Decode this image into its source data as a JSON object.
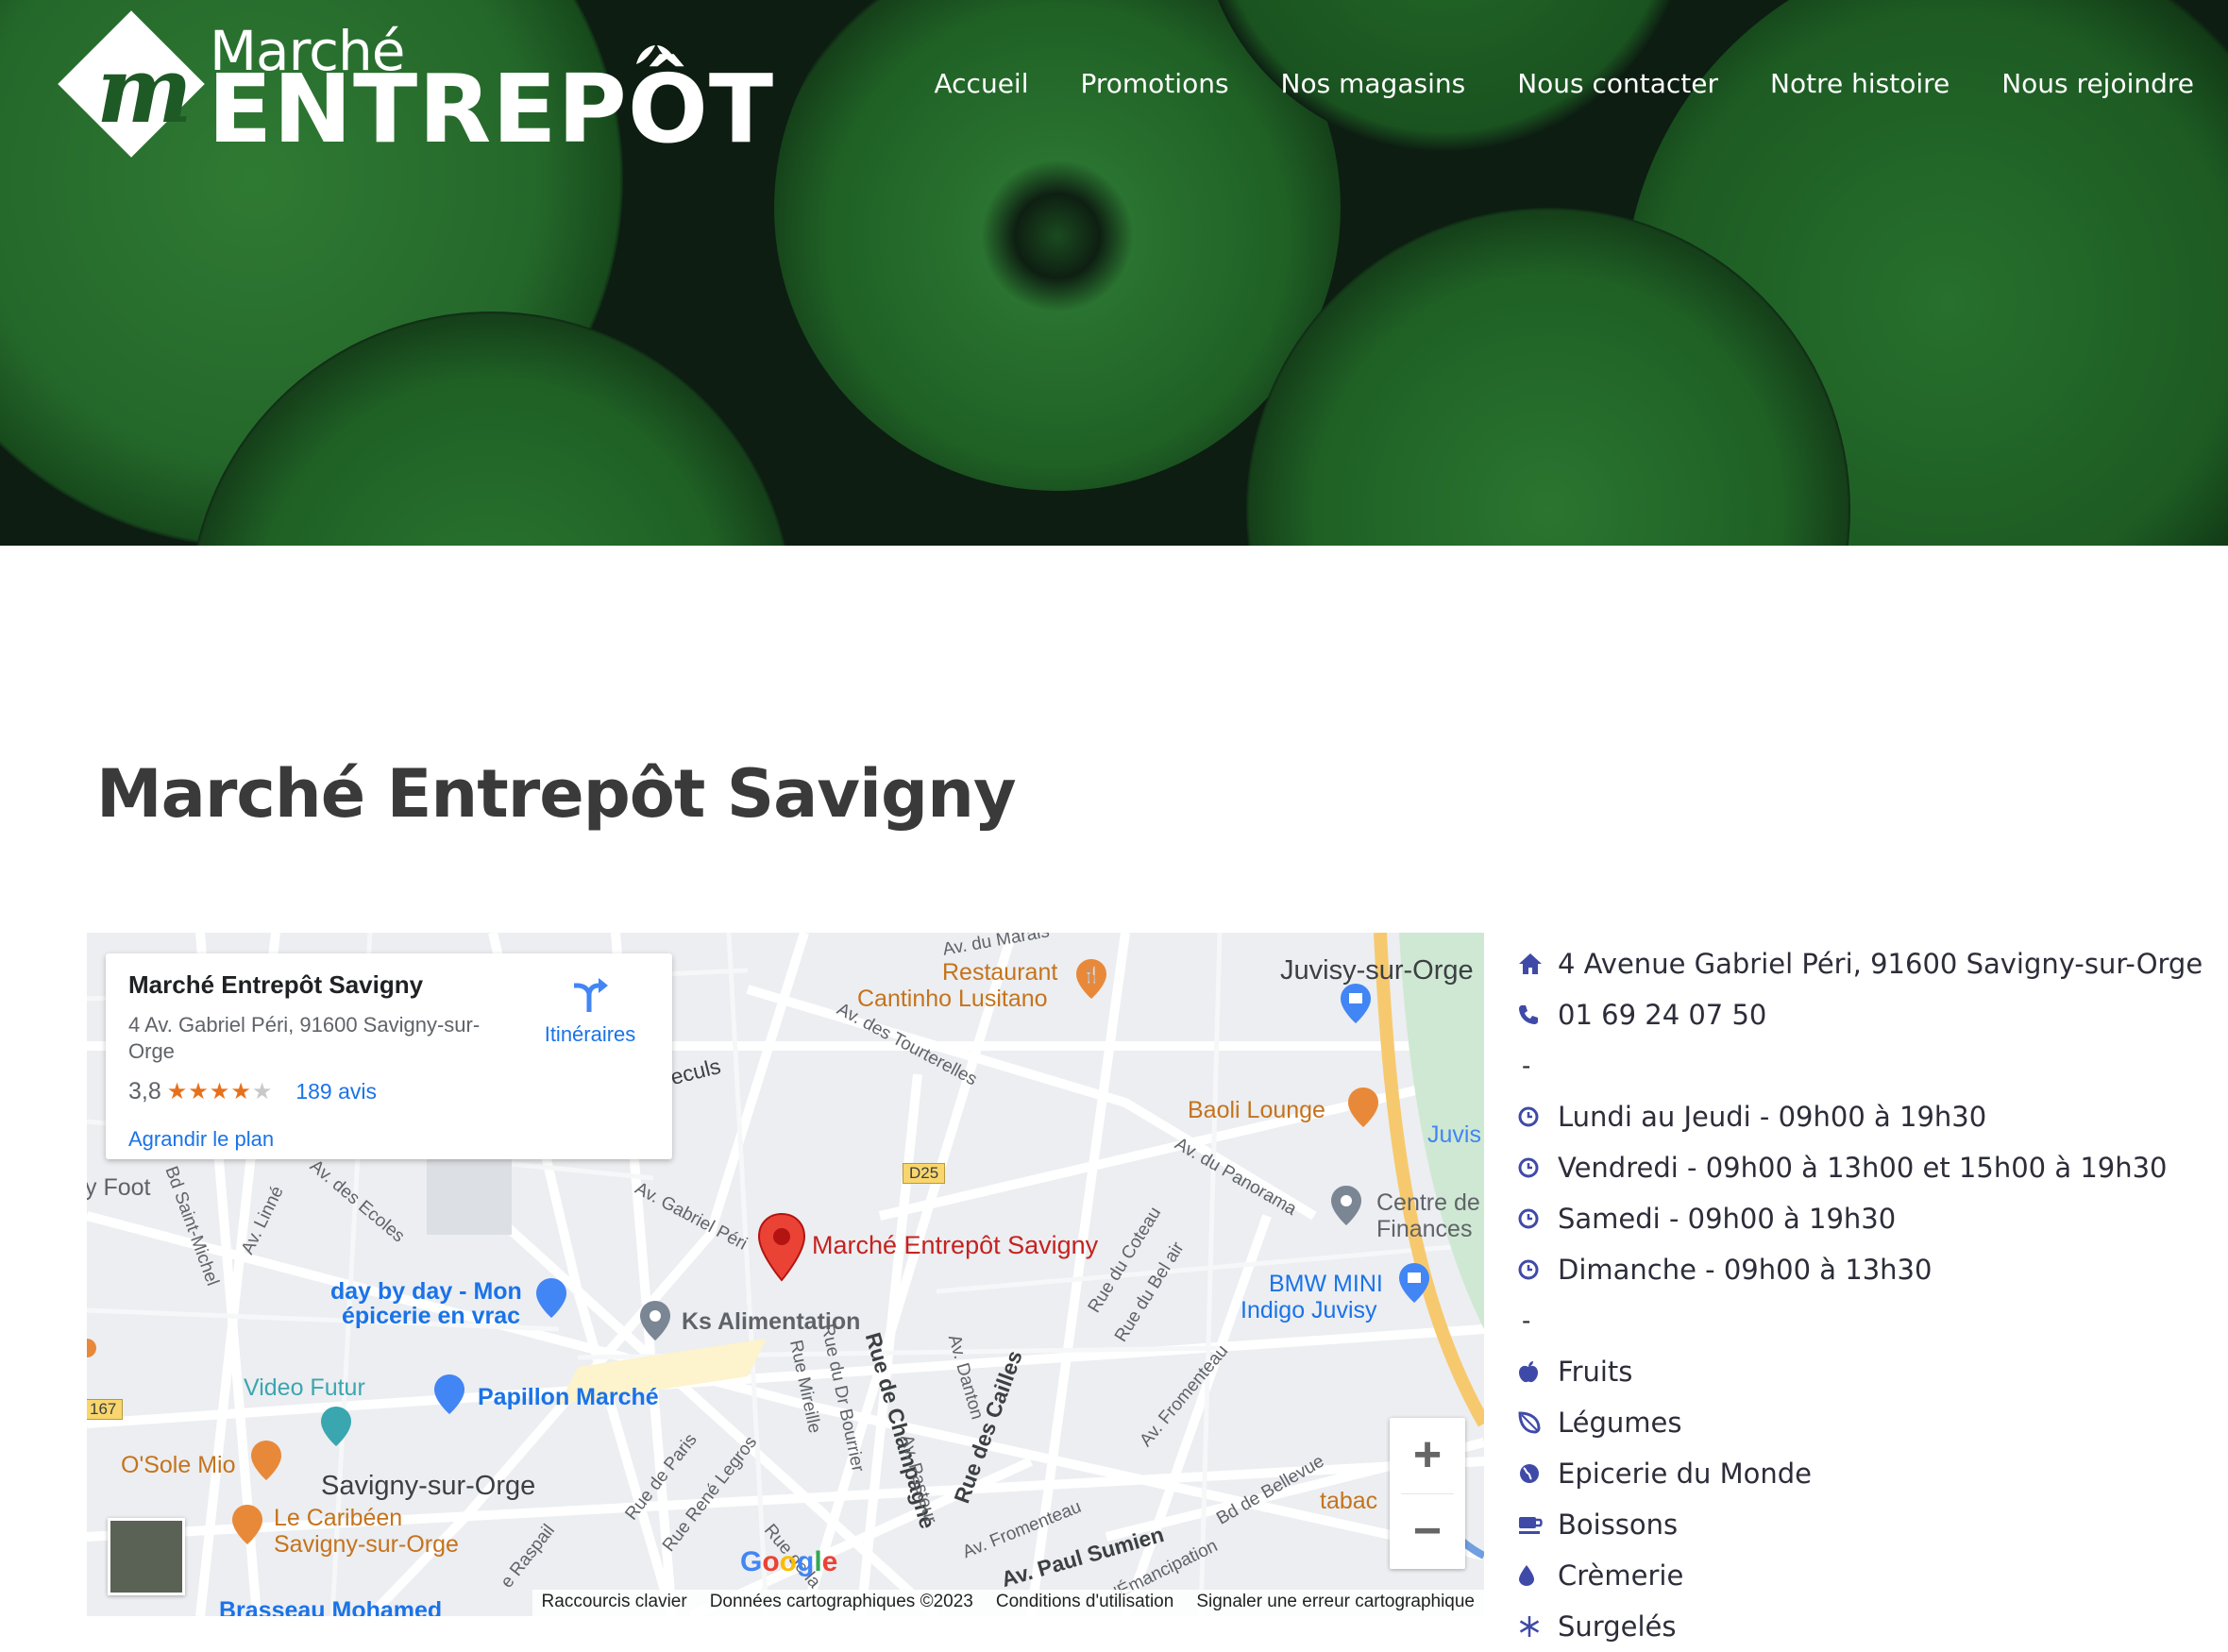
{
  "header": {
    "logo": {
      "top": "Marché",
      "bottom": "ENTREPÔT",
      "monogram": "m"
    },
    "nav": [
      {
        "label": "Accueil"
      },
      {
        "label": "Promotions"
      },
      {
        "label": "Nos magasins"
      },
      {
        "label": "Nous contacter"
      },
      {
        "label": "Notre histoire"
      },
      {
        "label": "Nous rejoindre"
      }
    ],
    "hero_tint": "#1e5a25"
  },
  "page_title": "Marché Entrepôt Savigny",
  "map": {
    "card": {
      "name": "Marché Entrepôt Savigny",
      "address": "4 Av. Gabriel Péri, 91600 Savigny-sur-Orge",
      "rating": "3,8",
      "rating_value": 3.8,
      "reviews": "189 avis",
      "directions": "Itinéraires",
      "enlarge": "Agrandir le plan"
    },
    "labels": {
      "pin": "Marché Entrepôt Savigny",
      "restaurant_1": "Restaurant",
      "restaurant_2": "Cantinho Lusitano",
      "juvisy": "Juvisy-sur-Orge",
      "juvis": "Juvis",
      "baoli": "Baoli Lounge",
      "centre_1": "Centre de",
      "centre_2": "Finances",
      "bmw_1": "BMW MINI",
      "bmw_2": "Indigo Juvisy",
      "dayby_1": "day by day - Mon",
      "dayby_2": "épicerie en vrac",
      "ks": "Ks Alimentation",
      "video": "Video Futur",
      "papillon": "Papillon Marché",
      "osole": "O'Sole Mio",
      "savigny": "Savigny-sur-Orge",
      "caribeen_1": "Le Caribéen",
      "caribeen_2": "Savigny-sur-Orge",
      "brasseau": "Brasseau Mohamed",
      "tabac": "tabac",
      "foot": "y Foot",
      "d25": "D25",
      "r167": "167",
      "streets": {
        "gabriel": "Av. Gabriel Péri",
        "tourterelles": "Av. des Tourterelles",
        "panorama": "Av. du Panorama",
        "coteau": "Rue du Coteau",
        "belair": "Rue du Bel air",
        "fromenteau": "Av. Fromenteau",
        "fromenteau2": "Av. Fromenteau",
        "bellevue": "Bd de Bellevue",
        "sumien": "Av. Paul Sumien",
        "cailles": "Rue des Cailles",
        "champagne": "Rue de Champagne",
        "danton": "Av. Danton",
        "pasteur": "Av. Pasteur",
        "bourrier": "Rue du Dr Bourrier",
        "mireille": "Rue Mireille",
        "legros": "Rue René Legros",
        "paris": "Rue de Paris",
        "raspail": "e Raspail",
        "linne": "Av. Linné",
        "ecoles": "Av. des Ecoles",
        "stmichel": "Bd Saint-Michel",
        "emancipation": "'Émancipation",
        "rue_de_la": "Rue de la",
        "eculs": "eculs",
        "marais": "Av. du Marais"
      }
    },
    "google": "Google",
    "attribution": [
      "Raccourcis clavier",
      "Données cartographiques ©2023",
      "Conditions d'utilisation",
      "Signaler une erreur cartographique"
    ],
    "zoom": {
      "in": "+",
      "out": "−"
    }
  },
  "store_info": {
    "address": "4 Avenue Gabriel Péri, 91600 Savigny-sur-Orge",
    "phone": "01 69 24 07 50",
    "separator": "-",
    "hours": [
      "Lundi au Jeudi - 09h00 à 19h30",
      "Vendredi - 09h00 à 13h00 et 15h00 à 19h30",
      "Samedi - 09h00 à 19h30",
      "Dimanche - 09h00 à 13h30"
    ],
    "departments": [
      {
        "label": "Fruits",
        "icon": "apple-icon"
      },
      {
        "label": "Légumes",
        "icon": "leaf-icon"
      },
      {
        "label": "Epicerie du Monde",
        "icon": "globe-icon"
      },
      {
        "label": "Boissons",
        "icon": "coffee-icon"
      },
      {
        "label": "Crèmerie",
        "icon": "drop-icon"
      },
      {
        "label": "Surgelés",
        "icon": "snowflake-icon"
      }
    ],
    "icon_color": "#3f4aa8"
  }
}
